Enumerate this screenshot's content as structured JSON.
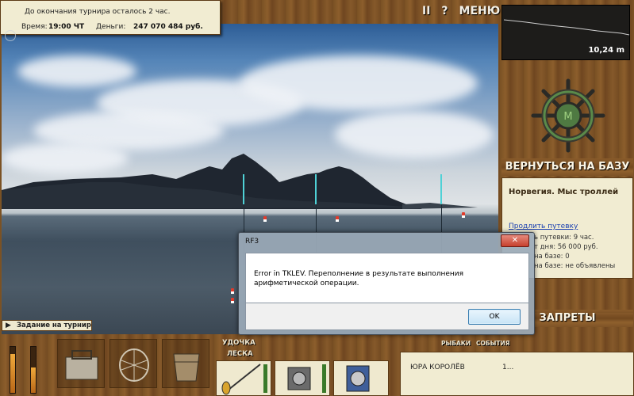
{
  "info": {
    "tournament_notice": "До окончания турнира осталось 2 час.",
    "time_label": "Время:",
    "time_value": "19:00 ЧТ",
    "money_label": "Деньги:",
    "money_value": "247 070 484 руб."
  },
  "controls": {
    "pause": "II",
    "help": "?",
    "menu": "МЕНЮ"
  },
  "depth": {
    "value": "10,24 m"
  },
  "sidebar": {
    "return_button": "ВЕРНУТЬСЯ НА БАЗУ",
    "location_title": "Норвегия. Мыс троллей",
    "extend_link": "Продлить путевку",
    "rows": [
      "ь путевки: 9 час.",
      "т дня: 56 000 руб.",
      "на базе: 0",
      "на базе: не объявлены"
    ],
    "bans_button": "ЗАПРЕТЫ"
  },
  "task_button": "Задание на турнир",
  "bottom": {
    "rod_label": "УДОЧКА",
    "line_label": "ЛЕСКА",
    "tab_fish": "РЫБАКИ",
    "tab_events": "СОБЫТИЯ",
    "player_name": "ЮРА КОРОЛЁВ",
    "player_score": "1..."
  },
  "dialog": {
    "title": "RF3",
    "close_glyph": "✕",
    "message": "Error in TKLEV. Переполнение в результате выполнения арифметической операции.",
    "ok": "OK"
  },
  "icons": {
    "arrow": "▶"
  }
}
